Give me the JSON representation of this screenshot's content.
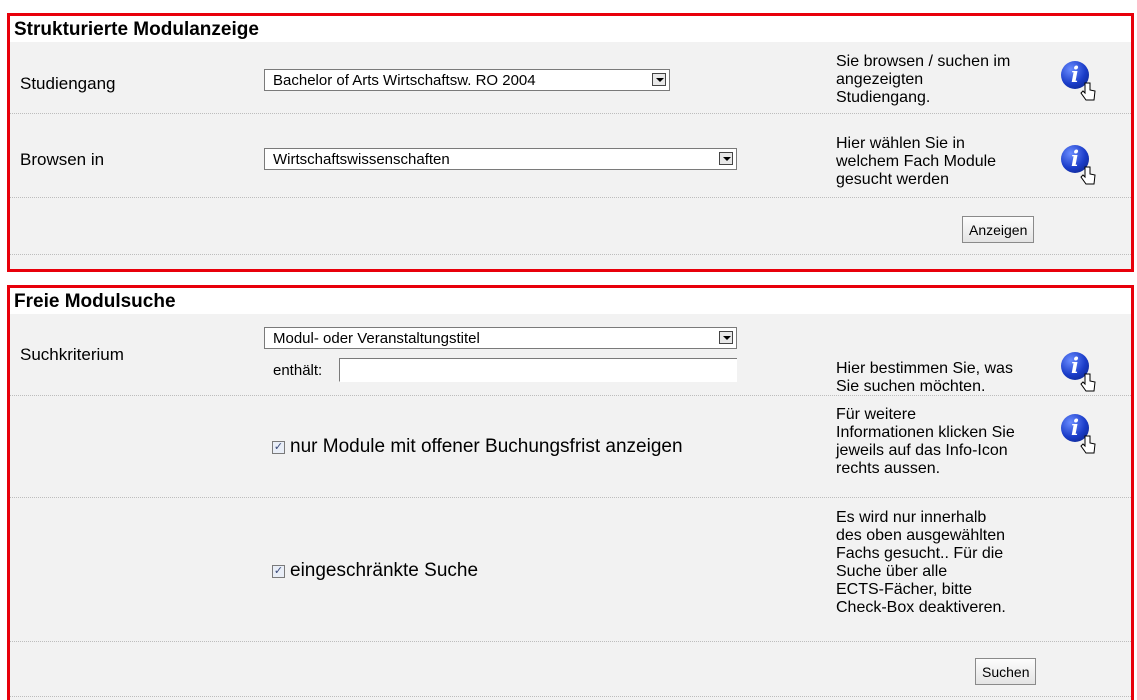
{
  "panel_struct": {
    "title": "Strukturierte Modulanzeige",
    "studiengang": {
      "label": "Studiengang",
      "value": "Bachelor of Arts Wirtschaftsw. RO 2004",
      "help": [
        "Sie browsen / suchen im",
        "angezeigten",
        "Studiengang."
      ]
    },
    "browsen": {
      "label": "Browsen in",
      "value": "Wirtschaftswissenschaften",
      "help": [
        "Hier wählen Sie in",
        "welchem Fach Module",
        "gesucht werden"
      ]
    },
    "button": "Anzeigen"
  },
  "panel_free": {
    "title": "Freie Modulsuche",
    "suchkriterium": {
      "label": "Suchkriterium",
      "value": "Modul- oder Veranstaltungstitel",
      "contains_label": "enthält:",
      "input_value": "",
      "help": [
        "Hier bestimmen Sie, was",
        "Sie suchen möchten."
      ]
    },
    "open_booking": {
      "checked": true,
      "label": "nur Module mit offener Buchungsfrist anzeigen",
      "help": [
        "Für weitere",
        "Informationen klicken Sie",
        "jeweils auf das Info-Icon",
        "rechts aussen."
      ]
    },
    "restricted": {
      "checked": true,
      "label": "eingeschränkte Suche",
      "help": [
        "Es wird nur innerhalb",
        "des oben ausgewählten",
        "Fachs gesucht.. Für die",
        "Suche über alle",
        "ECTS-Fächer, bitte",
        "Check-Box deaktiveren."
      ]
    },
    "button": "Suchen"
  },
  "icons": {
    "info": "info-icon",
    "pointer": "hand-pointer-icon"
  },
  "colors": {
    "panel_border": "#e8000b",
    "info_blue": "#1a3cc8"
  }
}
